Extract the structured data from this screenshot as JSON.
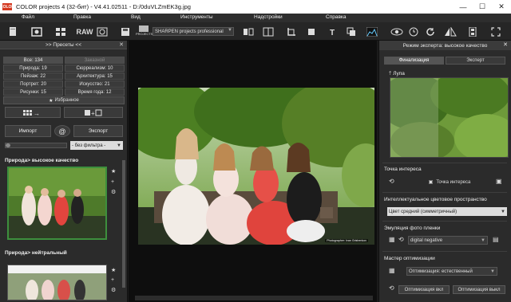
{
  "window": {
    "app_logo": "COLOR",
    "title": "COLOR projects 4 (32-бит) - V4.41.02511 - D:/0duVLZmEK3g.jpg",
    "minimize": "—",
    "maximize": "☐",
    "close": "✕"
  },
  "menu": [
    "Файл",
    "Правка",
    "Вид",
    "Инструменты",
    "Надстройки",
    "Справка"
  ],
  "toolbar": {
    "raw_label": "RAW",
    "projects_label": "PROJECTS",
    "preset_select": "SHARPEN projects professional"
  },
  "left_panel": {
    "header": ">> Пресеты <<",
    "close": "✕",
    "categories": [
      [
        "Все: 134",
        "Заказной"
      ],
      [
        "Природа: 19",
        "Сюрреализм: 10"
      ],
      [
        "Пейзаж: 22",
        "Архитектура: 15"
      ],
      [
        "Портрет: 20",
        "Искусство: 21"
      ],
      [
        "Рисунки: 15",
        "Время года: 12"
      ]
    ],
    "favorites": "Избранное",
    "import": "Импорт",
    "at": "@",
    "export": "Экспорт",
    "filter_select": "- без фильтра -",
    "preset1_title": "Природа> высокое качество",
    "preset2_title": "Природа> нейтральный"
  },
  "photo": {
    "caption": "Photographer: Ivan Grishenkov"
  },
  "right_panel": {
    "header": "Режим эксперта: высокое качество",
    "close": "✕",
    "tabs": [
      "Финализация",
      "Эксперт"
    ],
    "loupe": "Лупа",
    "poi_title": "Точка интереса",
    "poi_button": "Точка интереса",
    "smart_space_title": "Интеллектуальное цветовое пространство",
    "smart_space_select": "Цвет средний (симметричный)",
    "film_title": "Эмуляция фото пленки",
    "film_select": "digital negative",
    "optim_title": "Мастер оптимизации",
    "optim_select": "Оптимизация: естественный",
    "optim_on": "Оптимизация вкл",
    "optim_off": "Оптимизация выкл"
  }
}
